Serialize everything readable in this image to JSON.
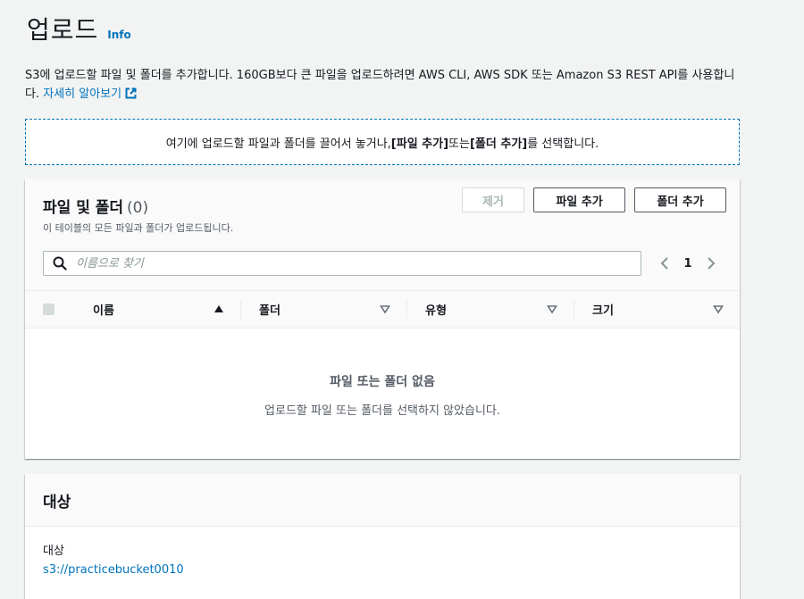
{
  "header": {
    "title": "업로드",
    "info": "Info"
  },
  "description": {
    "text": "S3에 업로드할 파일 및 폴더를 추가합니다. 160GB보다 큰 파일을 업로드하려면 AWS CLI, AWS SDK 또는 Amazon S3 REST API를 사용합니다.",
    "link": "자세히 알아보기",
    "link_icon": "external-link-icon"
  },
  "dropzone": {
    "before": "여기에 업로드할 파일과 폴더를 끌어서 놓거나, ",
    "add_file": "[파일 추가]",
    "middle": " 또는 ",
    "add_folder": "[폴더 추가]",
    "after": "를 선택합니다."
  },
  "files_panel": {
    "title": "파일 및 폴더",
    "count": "(0)",
    "subtitle": "이 테이블의 모든 파일과 폴더가 업로드됩니다.",
    "buttons": {
      "remove": "제거",
      "add_file": "파일 추가",
      "add_folder": "폴더 추가"
    },
    "search_placeholder": "이름으로 찾기",
    "page": "1",
    "columns": [
      "이름",
      "폴더",
      "유형",
      "크기"
    ],
    "empty_title": "파일 또는 폴더 없음",
    "empty_sub": "업로드할 파일 또는 폴더를 선택하지 않았습니다."
  },
  "destination_panel": {
    "title": "대상",
    "label": "대상",
    "value": "s3://practicebucket0010"
  },
  "colors": {
    "link": "#0073bb",
    "background": "#f2f3f3",
    "text": "#16191f",
    "muted": "#545b64"
  }
}
